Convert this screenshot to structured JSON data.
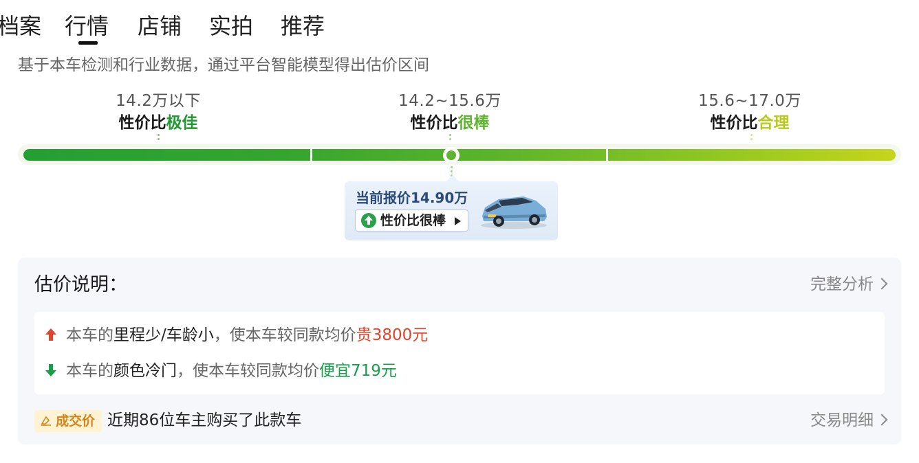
{
  "tabs": [
    {
      "label": "档案"
    },
    {
      "label": "行情"
    },
    {
      "label": "店铺"
    },
    {
      "label": "实拍"
    },
    {
      "label": "推荐"
    }
  ],
  "active_tab": "行情",
  "description": "基于本车检测和行业数据，通过平台智能模型得出估价区间",
  "ranges": [
    {
      "value": "14.2万以下",
      "prefix": "性价比",
      "rating": "极佳",
      "color": "#1f9a31"
    },
    {
      "value": "14.2~15.6万",
      "prefix": "性价比",
      "rating": "很棒",
      "color": "#5fb430"
    },
    {
      "value": "15.6~17.0万",
      "prefix": "性价比",
      "rating": "合理",
      "color": "#b7cc1c"
    }
  ],
  "current": {
    "price_label": "当前报价14.90万",
    "badge_label": "性价比很棒"
  },
  "estimate": {
    "title": "估价说明：",
    "full_analysis": "完整分析",
    "reasons": [
      {
        "pre": "本车的",
        "factor": "里程少/车龄小",
        "mid": "，使本车较同款均价",
        "effect": "贵3800元",
        "direction": "up"
      },
      {
        "pre": "本车的",
        "factor": "颜色冷门",
        "mid": "，使本车较同款均价",
        "effect": "便宜719元",
        "direction": "down"
      }
    ],
    "deal_badge": "成交价",
    "deal_text": "近期86位车主购买了此款车",
    "trade_detail": "交易明细"
  },
  "colors": {
    "up": "#e0442a",
    "down": "#16a04a",
    "badge_bg": "#fff3d4",
    "badge_text": "#d5841a"
  },
  "icons": [
    "arrow-up-icon",
    "arrow-down-icon",
    "up-circle-icon",
    "triangle-right-icon",
    "chevron-right-icon",
    "tag-icon",
    "car-image"
  ]
}
